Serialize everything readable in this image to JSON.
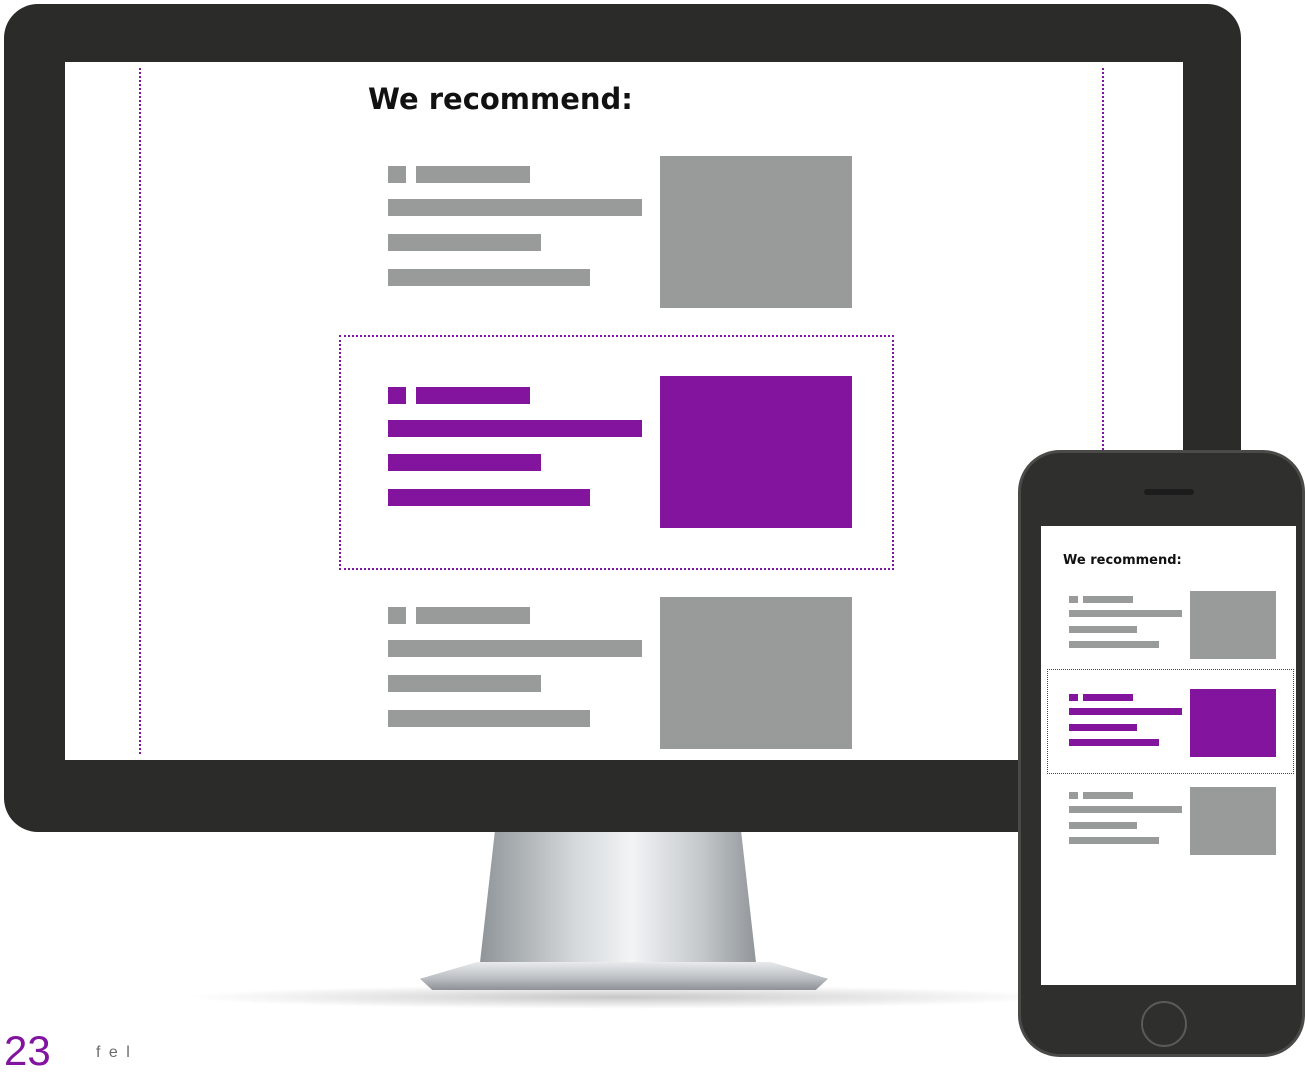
{
  "desktop": {
    "headline": "We recommend:",
    "cards": [
      {
        "state": "default"
      },
      {
        "state": "highlighted"
      },
      {
        "state": "default"
      }
    ]
  },
  "mobile": {
    "headline": "We recommend:",
    "cards": [
      {
        "state": "default"
      },
      {
        "state": "highlighted"
      },
      {
        "state": "default"
      }
    ]
  },
  "footer": {
    "page_number": "23",
    "label": "f e l"
  },
  "colors": {
    "accent": "#82149e",
    "placeholder": "#999a9a",
    "device_frame": "#2b2b2a"
  }
}
